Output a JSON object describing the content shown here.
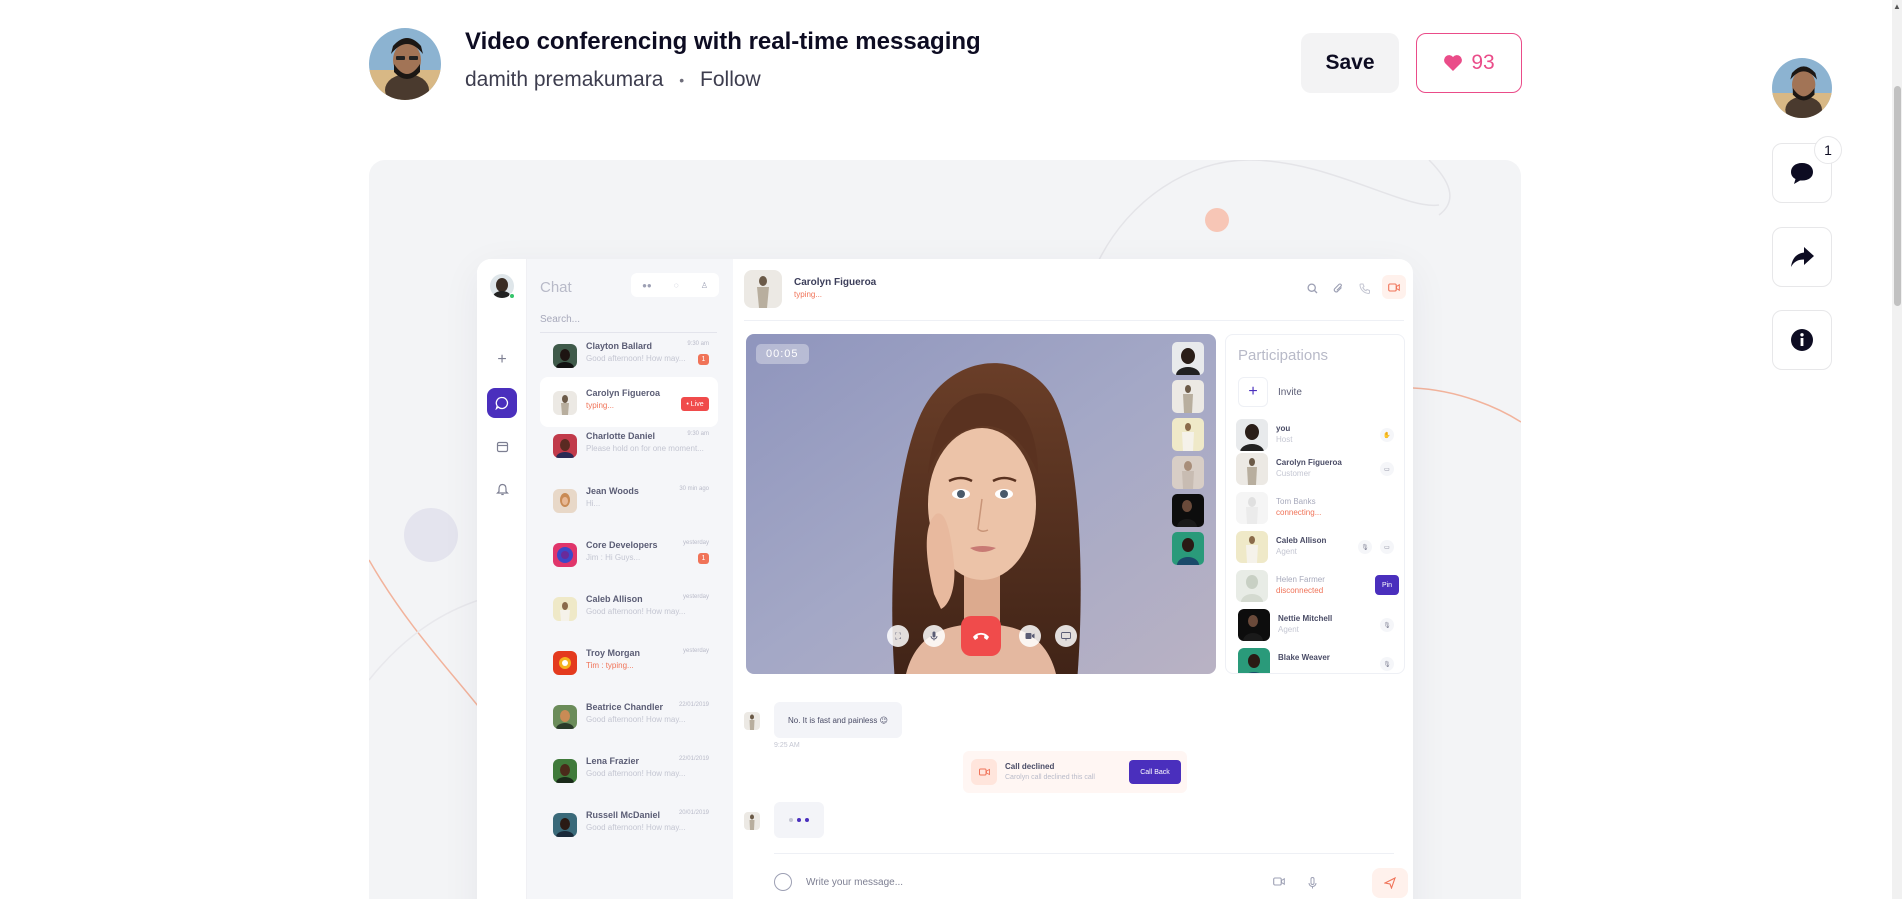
{
  "shot": {
    "title": "Video conferencing with real-time messaging",
    "author": "damith premakumara",
    "separator": "•",
    "follow_label": "Follow",
    "save_label": "Save",
    "like_count": "93"
  },
  "rail": {
    "comment_count": "1"
  },
  "app": {
    "chat_title": "Chat",
    "search_placeholder": "Search...",
    "chats": [
      {
        "name": "Clayton Ballard",
        "msg": "Good afternoon! How may...",
        "time": "9:30 am",
        "badge": "1"
      },
      {
        "name": "Carolyn Figueroa",
        "msg": "typing...",
        "live": "• Live"
      },
      {
        "name": "Charlotte Daniel",
        "msg": "Please hold on for one moment...",
        "time": "9:30 am"
      },
      {
        "name": "Jean Woods",
        "msg": "Hi...",
        "time": "30 min ago"
      },
      {
        "name": "Core Developers",
        "msg": "Jim : Hi Guys...",
        "time": "yesterday",
        "badge": "1"
      },
      {
        "name": "Caleb Allison",
        "msg": "Good afternoon! How may...",
        "time": "yesterday"
      },
      {
        "name": "Troy Morgan",
        "msg": "Tim : typing...",
        "time": "yesterday"
      },
      {
        "name": "Beatrice Chandler",
        "msg": "Good afternoon! How may...",
        "time": "22/01/2019"
      },
      {
        "name": "Lena Frazier",
        "msg": "Good afternoon! How may...",
        "time": "22/01/2019"
      },
      {
        "name": "Russell McDaniel",
        "msg": "Good afternoon! How may...",
        "time": "20/01/2019"
      }
    ],
    "conversation": {
      "name": "Carolyn Figueroa",
      "status": "typing..."
    },
    "call_timer": "00:05",
    "participants_title": "Participations",
    "invite_label": "Invite",
    "participants": [
      {
        "name": "you",
        "role": "Host"
      },
      {
        "name": "Carolyn Figueroa",
        "role": "Customer"
      },
      {
        "name": "Tom Banks",
        "role": "connecting..."
      },
      {
        "name": "Caleb Allison",
        "role": "Agent"
      },
      {
        "name": "Helen Farmer",
        "role": "disconnected",
        "action": "Pin"
      },
      {
        "name": "Nettie Mitchell",
        "role": "Agent"
      },
      {
        "name": "Blake Weaver",
        "role": ""
      }
    ],
    "message_text": "No. It is fast and painless 😉",
    "message_time": "9:25 AM",
    "call_declined_title": "Call declined",
    "call_declined_sub": "Carolyn call declined this call",
    "call_back_label": "Call Back",
    "compose_placeholder": "Write your message..."
  },
  "colors": {
    "accent": "#4a2fbd",
    "like": "#ea4c89",
    "alert": "#f07358",
    "end_call": "#f04b4b"
  }
}
